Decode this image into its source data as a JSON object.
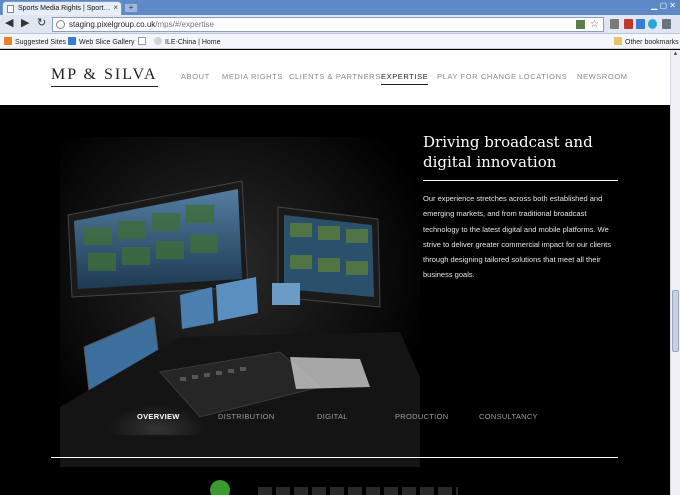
{
  "browser": {
    "tab_title": "Sports Media Rights | Sport…",
    "tab_close": "×",
    "new_tab": "+",
    "url_host": "staging.pixelgroup.co.uk",
    "url_path": "/mps/#/expertise",
    "bookmarks": [
      "Suggested Sites",
      "Web Slice Gallery",
      "ILE-China | Home"
    ],
    "other_bookmarks": "Other bookmarks"
  },
  "site": {
    "logo": "MP & SILVA",
    "nav": [
      "ABOUT",
      "MEDIA RIGHTS",
      "CLIENTS & PARTNERS",
      "EXPERTISE",
      "PLAY FOR CHANGE",
      "LOCATIONS",
      "NEWSROOM"
    ],
    "active_nav": "EXPERTISE"
  },
  "hero": {
    "headline": "Driving broadcast and digital innovation",
    "body": "Our experience stretches across both established and emerging markets, and from traditional broadcast technology to the latest digital and mobile platforms. We strive to deliver greater commercial impact for our clients through designing tailored solutions that meet all their business goals."
  },
  "subtabs": [
    "OVERVIEW",
    "DISTRIBUTION",
    "DIGITAL",
    "PRODUCTION",
    "CONSULTANCY"
  ],
  "active_subtab": "OVERVIEW",
  "colors": {
    "accent_green": "#3a9a2e",
    "chrome_blue": "#5d89c6"
  }
}
